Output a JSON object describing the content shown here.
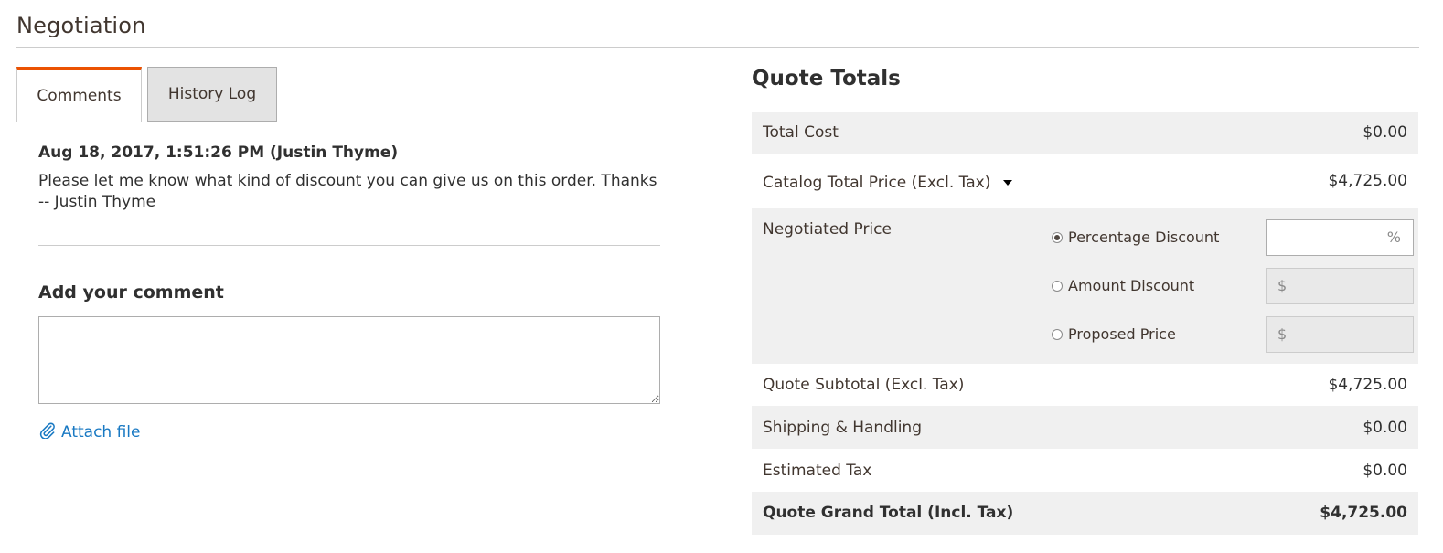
{
  "section": {
    "title": "Negotiation"
  },
  "tabs": [
    {
      "label": "Comments",
      "active": true
    },
    {
      "label": "History Log",
      "active": false
    }
  ],
  "comments": [
    {
      "meta": "Aug 18, 2017, 1:51:26 PM (Justin Thyme)",
      "text": "Please let me know what kind of discount you can give us on this order. Thanks -- Justin Thyme"
    }
  ],
  "add_comment": {
    "title": "Add your comment",
    "value": "",
    "attach_label": "Attach file"
  },
  "totals": {
    "title": "Quote Totals",
    "total_cost": {
      "label": "Total Cost",
      "value": "$0.00"
    },
    "catalog_total": {
      "label": "Catalog Total Price (Excl. Tax)",
      "value": "$4,725.00"
    },
    "negotiated": {
      "label": "Negotiated Price",
      "options": [
        {
          "label": "Percentage Discount",
          "checked": true,
          "unit": "%",
          "value": ""
        },
        {
          "label": "Amount Discount",
          "checked": false,
          "unit": "$",
          "value": ""
        },
        {
          "label": "Proposed Price",
          "checked": false,
          "unit": "$",
          "value": ""
        }
      ]
    },
    "subtotal": {
      "label": "Quote Subtotal (Excl. Tax)",
      "value": "$4,725.00"
    },
    "shipping": {
      "label": "Shipping & Handling",
      "value": "$0.00"
    },
    "tax": {
      "label": "Estimated Tax",
      "value": "$0.00"
    },
    "grand_total": {
      "label": "Quote Grand Total (Incl. Tax)",
      "value": "$4,725.00"
    }
  },
  "colors": {
    "accent": "#eb5202",
    "link": "#1979c3",
    "shaded_row": "#f0f0f0"
  }
}
